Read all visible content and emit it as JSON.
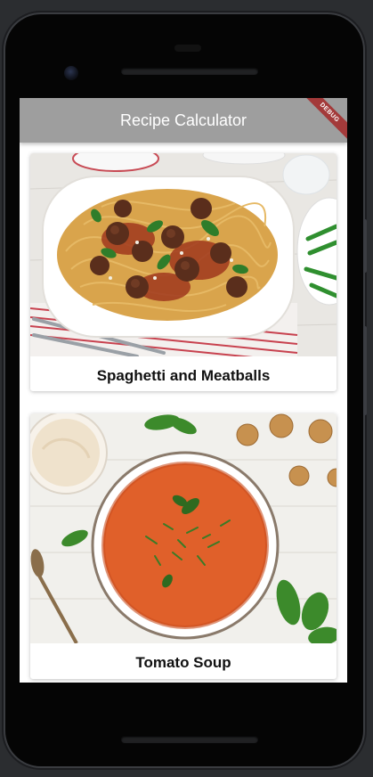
{
  "app_bar": {
    "title": "Recipe Calculator",
    "debug_banner": "DEBUG"
  },
  "recipes": [
    {
      "name": "Spaghetti and Meatballs",
      "image_icon": "spaghetti-meatballs-photo"
    },
    {
      "name": "Tomato Soup",
      "image_icon": "tomato-soup-photo"
    }
  ],
  "colors": {
    "app_bar": "#9e9e9e",
    "debug_banner": "#a33a3a",
    "soup": "#e0602a",
    "pasta": "#d9a44c"
  }
}
